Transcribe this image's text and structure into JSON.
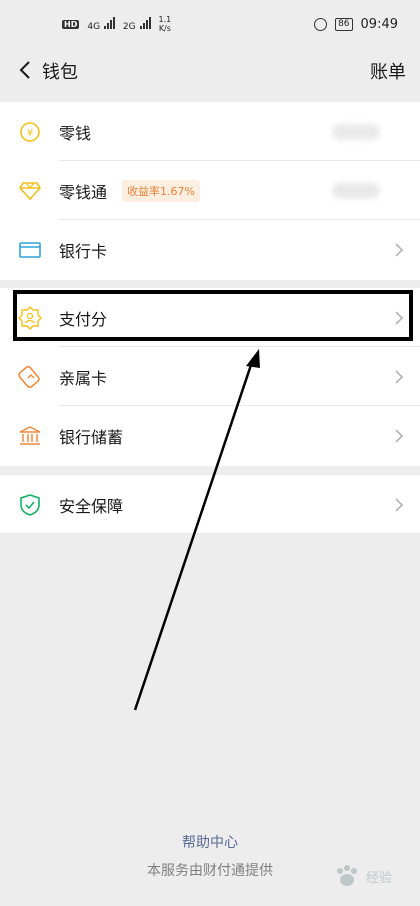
{
  "status": {
    "hd": "HD",
    "net1": "4G",
    "net2": "2G",
    "speed_value": "1.1",
    "speed_unit": "K/s",
    "battery": "86",
    "time": "09:49"
  },
  "nav": {
    "title": "钱包",
    "right": "账单"
  },
  "wallet_items": [
    {
      "label": "零钱",
      "icon": "yuan-coin-icon"
    },
    {
      "label": "零钱通",
      "icon": "diamond-icon",
      "badge": "收益率1.67%"
    },
    {
      "label": "银行卡",
      "icon": "bank-card-icon"
    }
  ],
  "service_items": [
    {
      "label": "支付分",
      "icon": "pay-score-icon"
    },
    {
      "label": "亲属卡",
      "icon": "family-card-icon"
    },
    {
      "label": "银行储蓄",
      "icon": "bank-savings-icon"
    }
  ],
  "security_items": [
    {
      "label": "安全保障",
      "icon": "shield-check-icon"
    }
  ],
  "footer": {
    "help": "帮助中心",
    "provider": "本服务由财付通提供"
  },
  "watermark": "经验",
  "colors": {
    "accent_yellow": "#f2c11b",
    "accent_orange": "#ef8a3c",
    "accent_blue": "#2fa3d8",
    "accent_green": "#14b364",
    "link_blue": "#576b95",
    "badge_bg": "#fdeee0",
    "badge_text": "#e5833a"
  }
}
